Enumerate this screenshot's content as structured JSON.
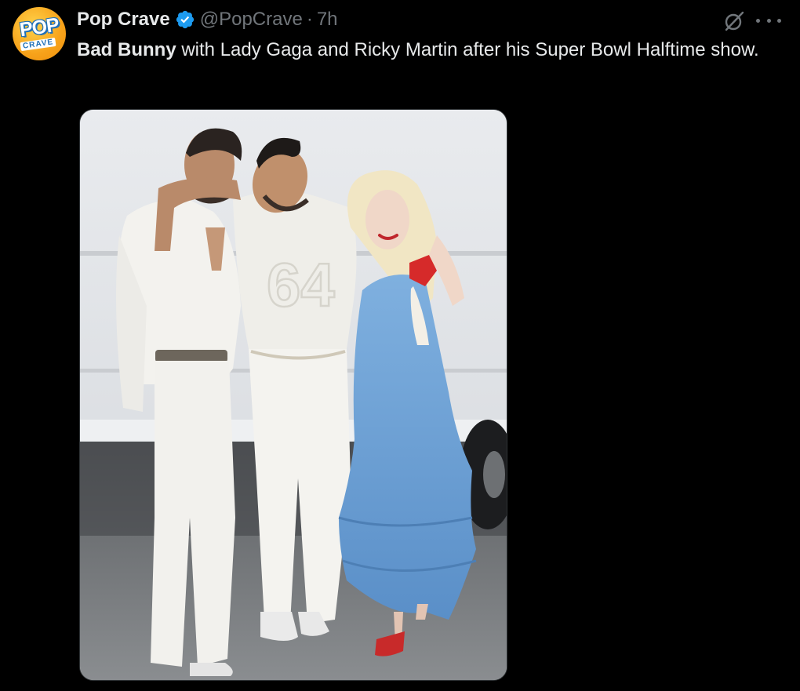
{
  "author": {
    "display_name": "Pop Crave",
    "handle": "@PopCrave",
    "separator": "·",
    "time": "7h",
    "avatar_text_top": "POP",
    "avatar_text_bottom": "CRAVE",
    "verified_icon": "verified-badge-icon",
    "verified_color": "#1d9bf0"
  },
  "tweet": {
    "text_bold": "Bad Bunny",
    "text_rest": " with Lady Gaga and Ricky Martin after his Super Bowl Halftime show."
  },
  "media": {
    "jersey_number": "64",
    "background_color": "#d8dbde",
    "dress_color": "#6ea3d6"
  },
  "actions": {
    "grok_icon": "grok-icon",
    "more_icon": "more-icon"
  },
  "colors": {
    "background": "#000000",
    "primary_text": "#e7e9ea",
    "secondary_text": "#71767b",
    "accent": "#1d9bf0"
  }
}
